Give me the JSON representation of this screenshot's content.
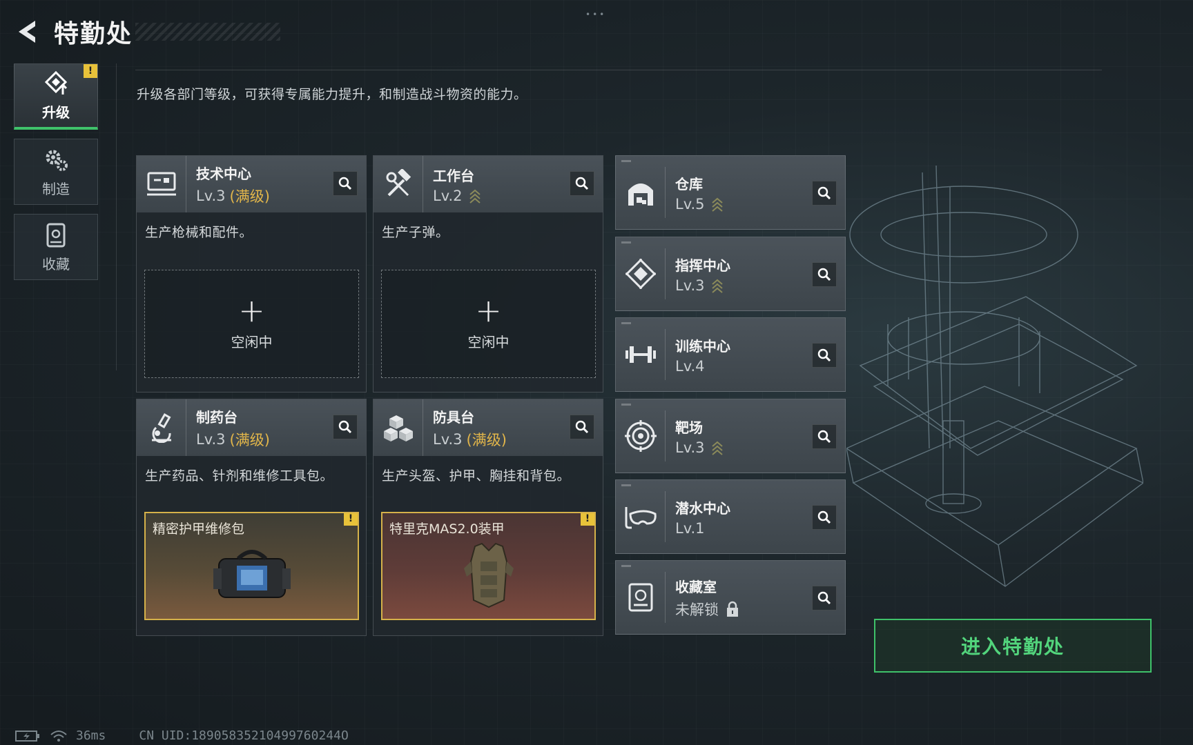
{
  "header": {
    "title": "特勤处",
    "back_icon": "back-arrow-icon"
  },
  "side_tabs": [
    {
      "label": "升级",
      "icon": "upgrade-icon",
      "active": true,
      "alert": "!"
    },
    {
      "label": "制造",
      "icon": "gear-icon",
      "active": false
    },
    {
      "label": "收藏",
      "icon": "collection-icon",
      "active": false
    }
  ],
  "description": "升级各部门等级，可获得专属能力提升，和制造战斗物资的能力。",
  "big_cards": [
    {
      "name": "技术中心",
      "level": "Lv.3",
      "max": "(满级)",
      "desc": "生产枪械和配件。",
      "slot_state": "空闲中",
      "plus": "+"
    },
    {
      "name": "工作台",
      "level": "Lv.2",
      "desc": "生产子弹。",
      "slot_state": "空闲中",
      "plus": "+"
    },
    {
      "name": "制药台",
      "level": "Lv.3",
      "max": "(满级)",
      "desc": "生产药品、针剂和维修工具包。",
      "item_name": "精密护甲维修包",
      "alert": "!"
    },
    {
      "name": "防具台",
      "level": "Lv.3",
      "max": "(满级)",
      "desc": "生产头盔、护甲、胸挂和背包。",
      "item_name": "特里克MAS2.0装甲",
      "alert": "!"
    }
  ],
  "small_cards": [
    {
      "name": "仓库",
      "level": "Lv.5",
      "icon": "warehouse-icon"
    },
    {
      "name": "指挥中心",
      "level": "Lv.3",
      "icon": "command-center-icon"
    },
    {
      "name": "训练中心",
      "level": "Lv.4",
      "icon": "dumbbell-icon"
    },
    {
      "name": "靶场",
      "level": "Lv.3",
      "icon": "target-icon"
    },
    {
      "name": "潜水中心",
      "level": "Lv.1",
      "icon": "diving-mask-icon"
    },
    {
      "name": "收藏室",
      "level": "未解锁",
      "icon": "collection-room-icon"
    }
  ],
  "enter_button": "进入特勤处",
  "footer": {
    "latency": "36ms",
    "uid": "CN UID:18905835210499760244O"
  },
  "colors": {
    "accent_green": "#3fc26a",
    "gold": "#e2b64a",
    "alert_yellow": "#e8c23a"
  }
}
